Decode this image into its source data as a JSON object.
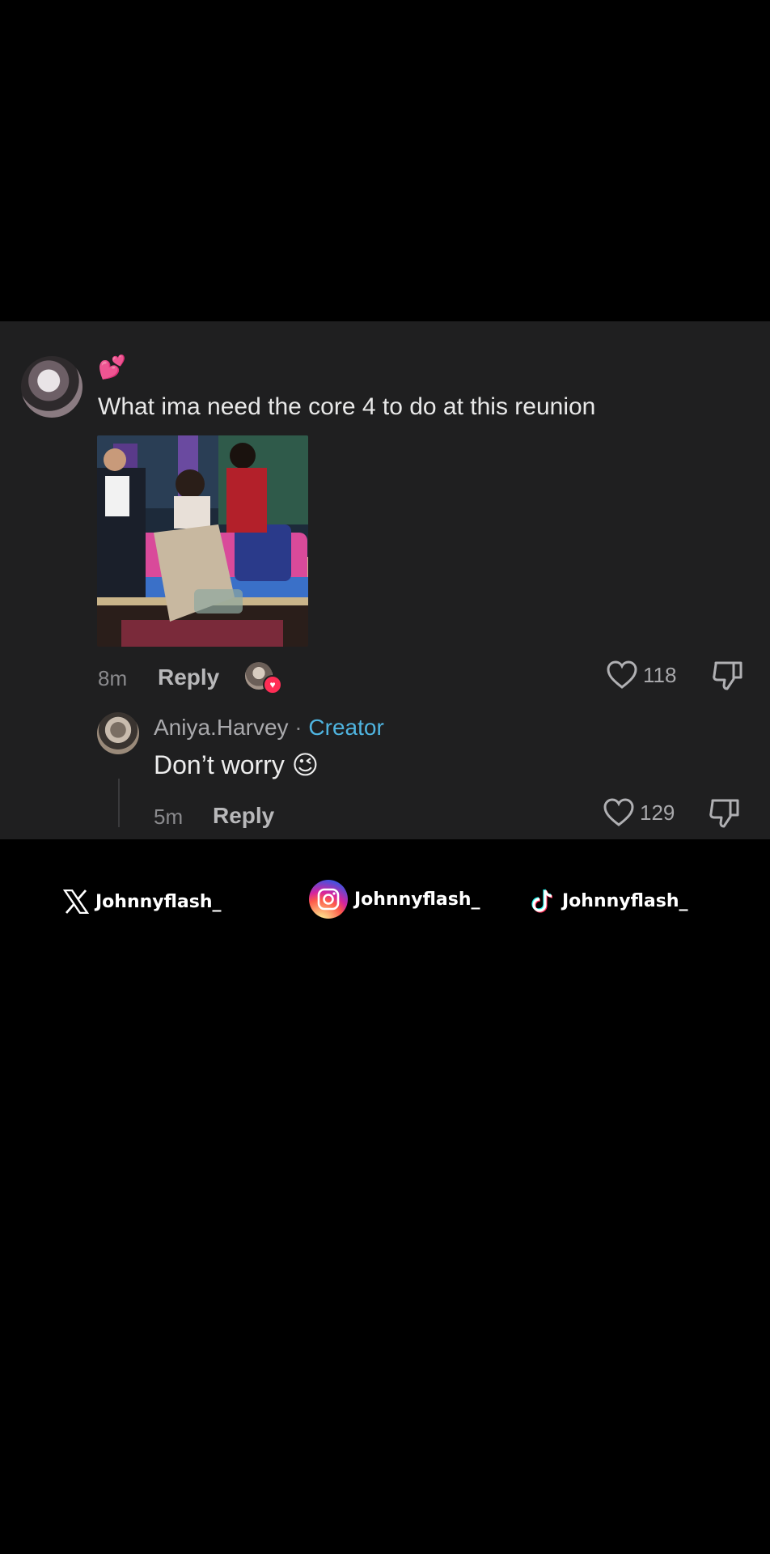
{
  "comment": {
    "emoji": "💕",
    "text": "What ima need the core 4 to do at this reunion",
    "time": "8m",
    "reply_label": "Reply",
    "likes": "118"
  },
  "reply": {
    "author": "Aniya.Harvey",
    "separator": "·",
    "badge": "Creator",
    "text": "Don’t worry 😉",
    "time": "5m",
    "reply_label": "Reply",
    "likes": "129"
  },
  "social": {
    "x_handle": "Johnnyflash_",
    "instagram_handle": "Johnnyflash_",
    "tiktok_handle": "Johnnyflash_"
  },
  "colors": {
    "background": "#000000",
    "panel": "#1f1f20",
    "creator_badge": "#4fb4e0",
    "like_heart": "#ff2d55"
  }
}
